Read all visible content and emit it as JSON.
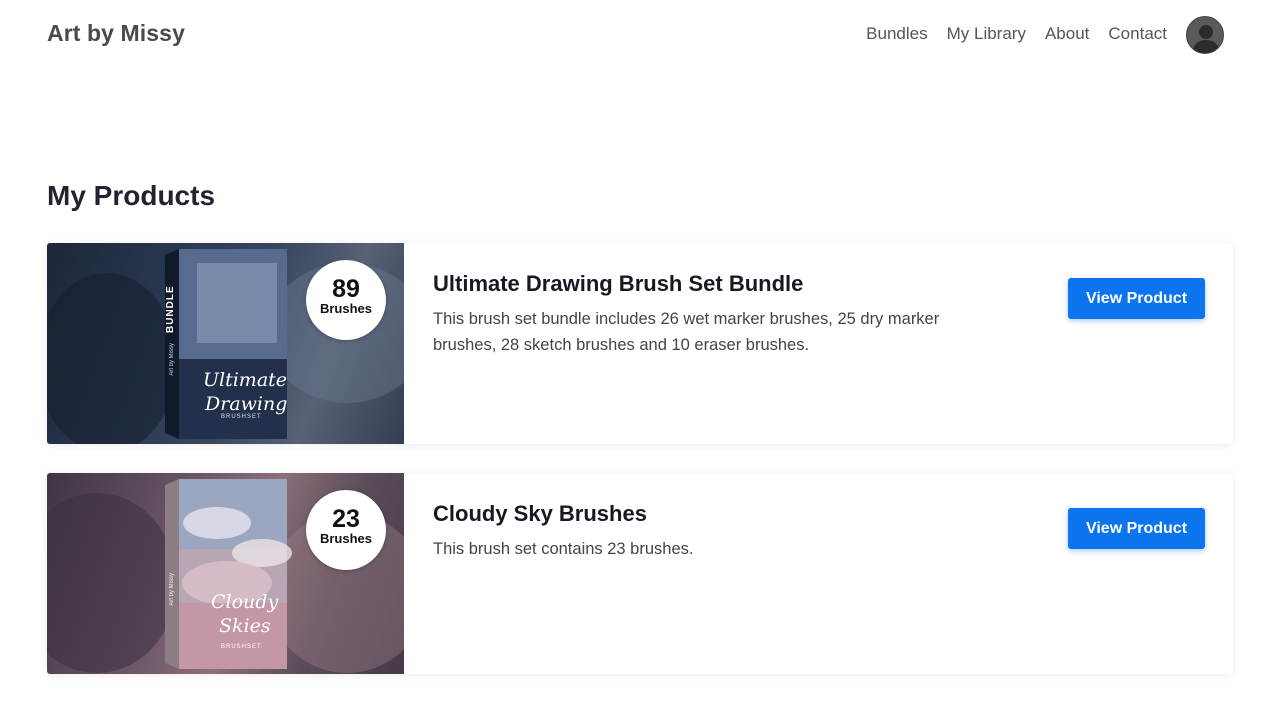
{
  "header": {
    "brand": "Art by Missy",
    "nav": [
      {
        "label": "Bundles"
      },
      {
        "label": "My Library"
      },
      {
        "label": "About"
      },
      {
        "label": "Contact"
      }
    ],
    "avatar_icon": "user-avatar-icon"
  },
  "main": {
    "title": "My Products",
    "products": [
      {
        "badge_count": "89",
        "badge_label": "Brushes",
        "box_spine": "BUNDLE",
        "box_side": "Art by Missy",
        "box_title_1": "Ultimate",
        "box_title_2": "Drawing",
        "box_sub": "BRUSHSET",
        "title": "Ultimate Drawing Brush Set Bundle",
        "description": "This brush set bundle includes 26 wet marker brushes, 25 dry marker brushes, 28 sketch brushes and 10 eraser brushes.",
        "button": "View Product"
      },
      {
        "badge_count": "23",
        "badge_label": "Brushes",
        "box_side": "Art by Missy",
        "box_title_1": "Cloudy",
        "box_title_2": "Skies",
        "box_sub": "BRUSHSET",
        "title": "Cloudy Sky Brushes",
        "description": "This brush set contains 23 brushes.",
        "button": "View Product"
      }
    ]
  },
  "colors": {
    "accent": "#0b74ee",
    "title": "#1f2430",
    "brand": "#4a4a4a"
  }
}
